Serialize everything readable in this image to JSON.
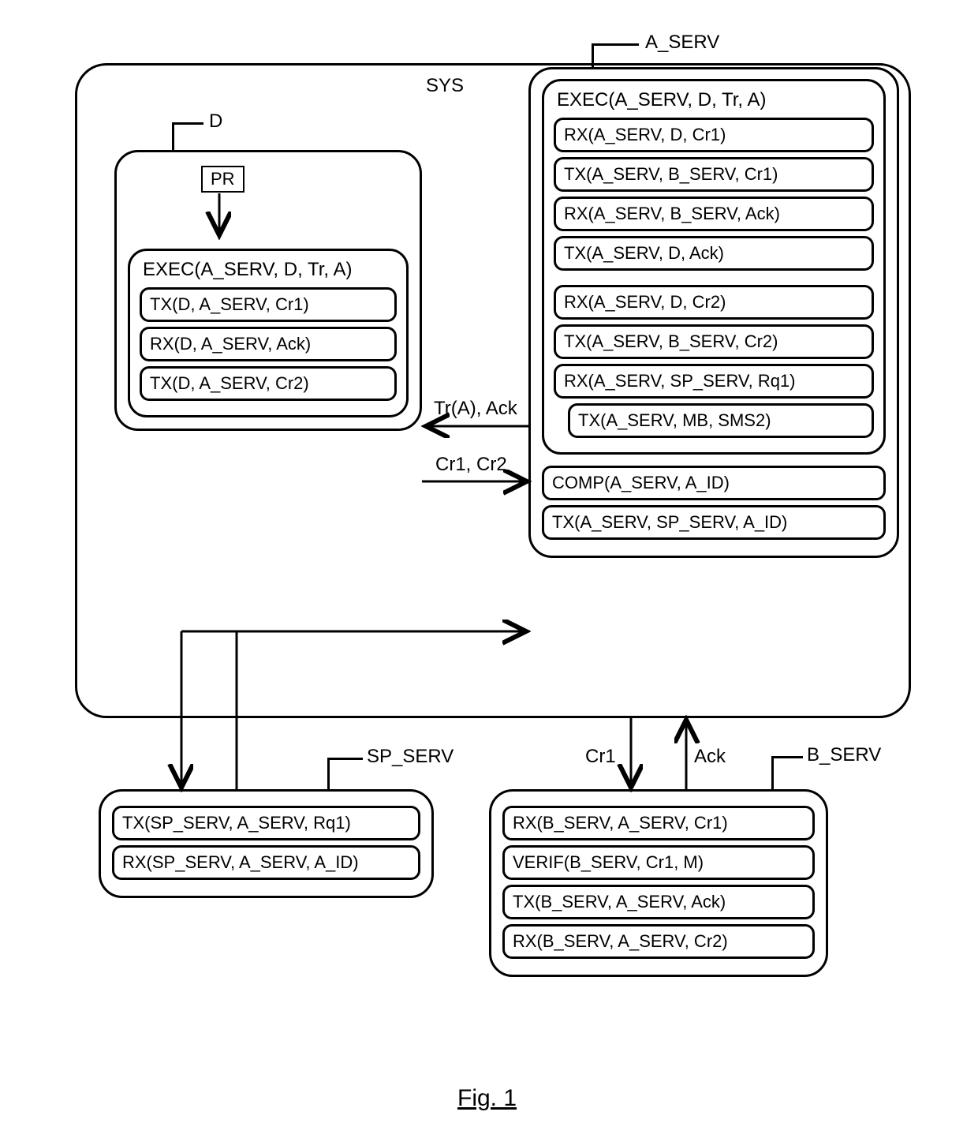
{
  "labels": {
    "sys": "SYS",
    "d": "D",
    "a_serv": "A_SERV",
    "sp_serv": "SP_SERV",
    "b_serv": "B_SERV",
    "caption": "Fig. 1",
    "pr": "PR",
    "flow_tr_ack": "Tr(A), Ack",
    "flow_cr1_cr2": "Cr1, Cr2",
    "flow_cr1": "Cr1",
    "flow_ack": "Ack"
  },
  "d_block": {
    "exec_title": "EXEC(A_SERV, D, Tr, A)",
    "steps": [
      "TX(D, A_SERV, Cr1)",
      "RX(D, A_SERV, Ack)",
      "TX(D, A_SERV, Cr2)"
    ]
  },
  "a_serv_block": {
    "exec_title": "EXEC(A_SERV, D, Tr, A)",
    "exec_steps": [
      "RX(A_SERV, D, Cr1)",
      "TX(A_SERV, B_SERV, Cr1)",
      "RX(A_SERV, B_SERV, Ack)",
      "TX(A_SERV, D,  Ack)",
      "RX(A_SERV, D, Cr2)",
      "TX(A_SERV, B_SERV, Cr2)",
      "RX(A_SERV, SP_SERV,  Rq1)",
      "TX(A_SERV, MB, SMS2)"
    ],
    "tail_steps": [
      "COMP(A_SERV, A_ID)",
      "TX(A_SERV, SP_SERV,  A_ID)"
    ]
  },
  "sp_serv_block": {
    "steps": [
      "TX(SP_SERV, A_SERV, Rq1)",
      "RX(SP_SERV, A_SERV,  A_ID)"
    ]
  },
  "b_serv_block": {
    "steps": [
      "RX(B_SERV, A_SERV, Cr1)",
      "VERIF(B_SERV, Cr1, M)",
      "TX(B_SERV, A_SERV, Ack)",
      "RX(B_SERV, A_SERV, Cr2)"
    ]
  }
}
